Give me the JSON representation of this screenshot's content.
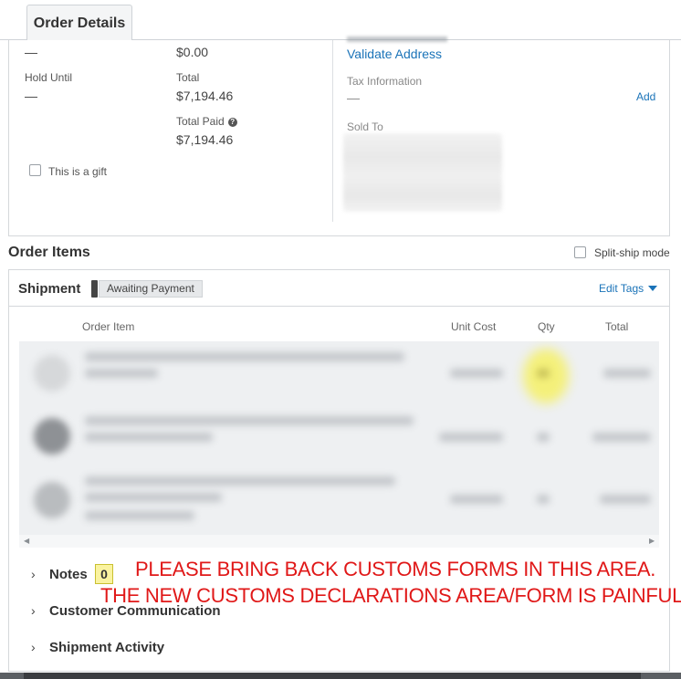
{
  "tabs": {
    "order_details": "Order Details"
  },
  "order_info": {
    "requested_value": "—",
    "shipping_paid_value": "$0.00",
    "hold_until_label": "Hold Until",
    "hold_until_value": "—",
    "total_label": "Total",
    "total_value": "$7,194.46",
    "total_paid_label": "Total Paid",
    "total_paid_value": "$7,194.46",
    "gift_label": "This is a gift",
    "validate_address": "Validate Address",
    "tax_info_label": "Tax Information",
    "tax_info_value": "—",
    "add_link": "Add",
    "sold_to_label": "Sold To"
  },
  "order_items": {
    "title": "Order Items",
    "split_ship_label": "Split-ship mode"
  },
  "shipment": {
    "title": "Shipment",
    "status_badge": "Awaiting Payment",
    "edit_tags": "Edit Tags",
    "columns": [
      "Order Item",
      "Unit Cost",
      "Qty",
      "Total"
    ],
    "row_count": 3
  },
  "sections": {
    "notes": "Notes",
    "notes_count": "0",
    "customer_communication": "Customer Communication",
    "shipment_activity": "Shipment Activity"
  },
  "annotation": {
    "line1": "PLEASE BRING BACK CUSTOMS FORMS IN THIS AREA.",
    "line2": "THE NEW CUSTOMS DECLARATIONS AREA/FORM IS PAINFUL.",
    "color": "#e01818"
  },
  "colors": {
    "link": "#1a73b8",
    "highlight": "#faf3a0"
  }
}
